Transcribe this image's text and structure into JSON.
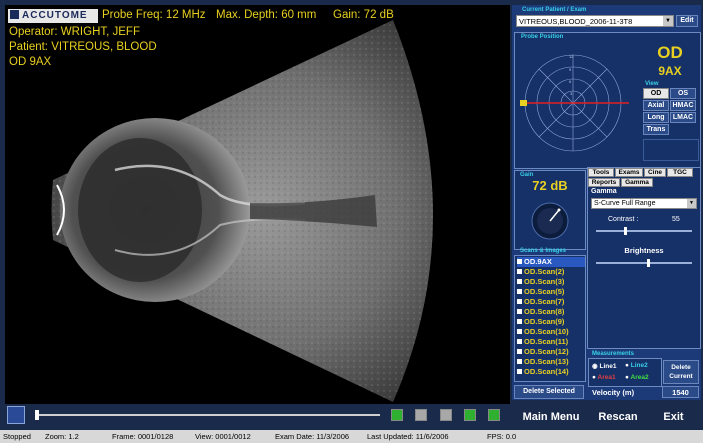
{
  "overlay": {
    "brand": "ACCUTOME",
    "probe_freq": "Probe Freq: 12 MHz",
    "max_depth": "Max. Depth: 60 mm",
    "gain": "Gain: 72 dB",
    "operator": "Operator: WRIGHT, JEFF",
    "patient": "Patient: VITREOUS, BLOOD",
    "scan_id": "OD  9AX"
  },
  "panel": {
    "patient_label": "Current Patient / Exam",
    "patient_select": "VITREOUS,BLOOD_2006-11-3T8",
    "edit_label": "Edit",
    "probe_label": "Probe Position",
    "eye": "OD",
    "position": "9AX",
    "view_label": "View",
    "eye_buttons": [
      "OD",
      "OS"
    ],
    "view_buttons": [
      [
        "Axial",
        "HMAC"
      ],
      [
        "Long",
        "LMAC"
      ],
      [
        "Trans",
        ""
      ]
    ],
    "gain_label": "Gain",
    "gain_value": "72 dB",
    "scans_label": "Scans & Images",
    "scans": [
      "OD.9AX",
      "OD.Scan(2)",
      "OD.Scan(3)",
      "OD.Scan(5)",
      "OD.Scan(7)",
      "OD.Scan(8)",
      "OD.Scan(9)",
      "OD.Scan(10)",
      "OD.Scan(11)",
      "OD.Scan(12)",
      "OD.Scan(13)",
      "OD.Scan(14)"
    ],
    "delete_selected": "Delete Selected",
    "tabs_row1": [
      "Tools",
      "Exams",
      "Cine",
      "TGC"
    ],
    "tabs_row2": [
      "Reports",
      "Gamma"
    ],
    "gamma_title": "Gamma",
    "gamma_curve": "S-Curve  Full Range",
    "contrast_label": "Contrast :",
    "contrast_value": "55",
    "contrast_level": 0.3,
    "brightness_label": "Brightness",
    "brightness_level": 0.55,
    "measure_label": "Measurements",
    "lines": [
      "Line1",
      "Line2"
    ],
    "areas": [
      "Area1",
      "Area2"
    ],
    "delete_current": "Delete Current",
    "velocity_label": "Velocity (m)",
    "velocity_value": "1540",
    "main_menu": "Main Menu",
    "rescan": "Rescan",
    "exit": "Exit"
  },
  "status": {
    "state": "Stopped",
    "zoom": "Zoom: 1.2",
    "frame": "Frame: 0001/0128",
    "view": "View: 0001/0012",
    "exam_date": "Exam Date: 11/3/2006",
    "last_updated": "Last Updated: 11/6/2006",
    "fps": "FPS: 0.0"
  },
  "colors": {
    "accent_yellow": "#e8d020",
    "panel_blue": "#1c3a78",
    "label_cyan": "#38d0e8"
  }
}
